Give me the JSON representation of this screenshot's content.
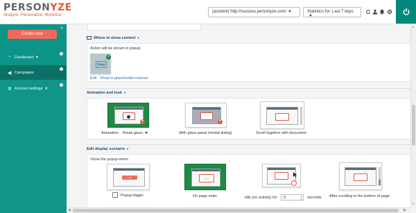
{
  "header": {
    "logo_text_a": "PERSON",
    "logo_text_b": "YZE",
    "tagline": "Analyze. Personalize. Monetize",
    "site_selector": "(asistent) http://success.personyze.com/",
    "stats_selector": "Statistics for: Last 7 days",
    "icons": [
      "refresh-icon",
      "user-icon",
      "bell-icon",
      "gear-icon",
      "power-icon"
    ]
  },
  "sidebar": {
    "collapse_glyph": "«",
    "create_button": "Create now",
    "items": [
      {
        "label": "Dashboard",
        "icon": "dashboard-icon",
        "has_chevron": true
      },
      {
        "label": "Campaigns",
        "icon": "megaphone-icon",
        "has_chevron": false,
        "active": true
      },
      {
        "label": "Account settings",
        "icon": "gears-icon",
        "has_chevron": true
      }
    ],
    "info_glyph": "i"
  },
  "sections": {
    "where": {
      "title": "Where to show content",
      "action_text": "Action will be shown in popup:",
      "thumb_label": "Popup",
      "edit_link": "Edit",
      "placeholder_link": "Show in placeholder instead"
    },
    "animation": {
      "title": "Animation and look",
      "animation_label": "Animation:",
      "animation_value": "Break glass",
      "option2": "With glass panel (modal dialog)",
      "option3": "Scroll together with document"
    },
    "display": {
      "title": "Edit display scenario",
      "show_when": "Show the popup when:",
      "trigger_btn": "I AM",
      "opt1": "Popup trigger",
      "opt2_text": "Hi !",
      "opt2": "On page enter",
      "opt3_prefix": "Idle (no activity) for",
      "opt3_value": "0",
      "opt3_suffix": "seconds",
      "opt4": "After scrolling to the bottom of page"
    }
  },
  "colors": {
    "brand_teal": "#0f9688",
    "accent_orange": "#e05a3a",
    "selected_green": "#1e8a44",
    "link_blue": "#2a6fb0"
  }
}
